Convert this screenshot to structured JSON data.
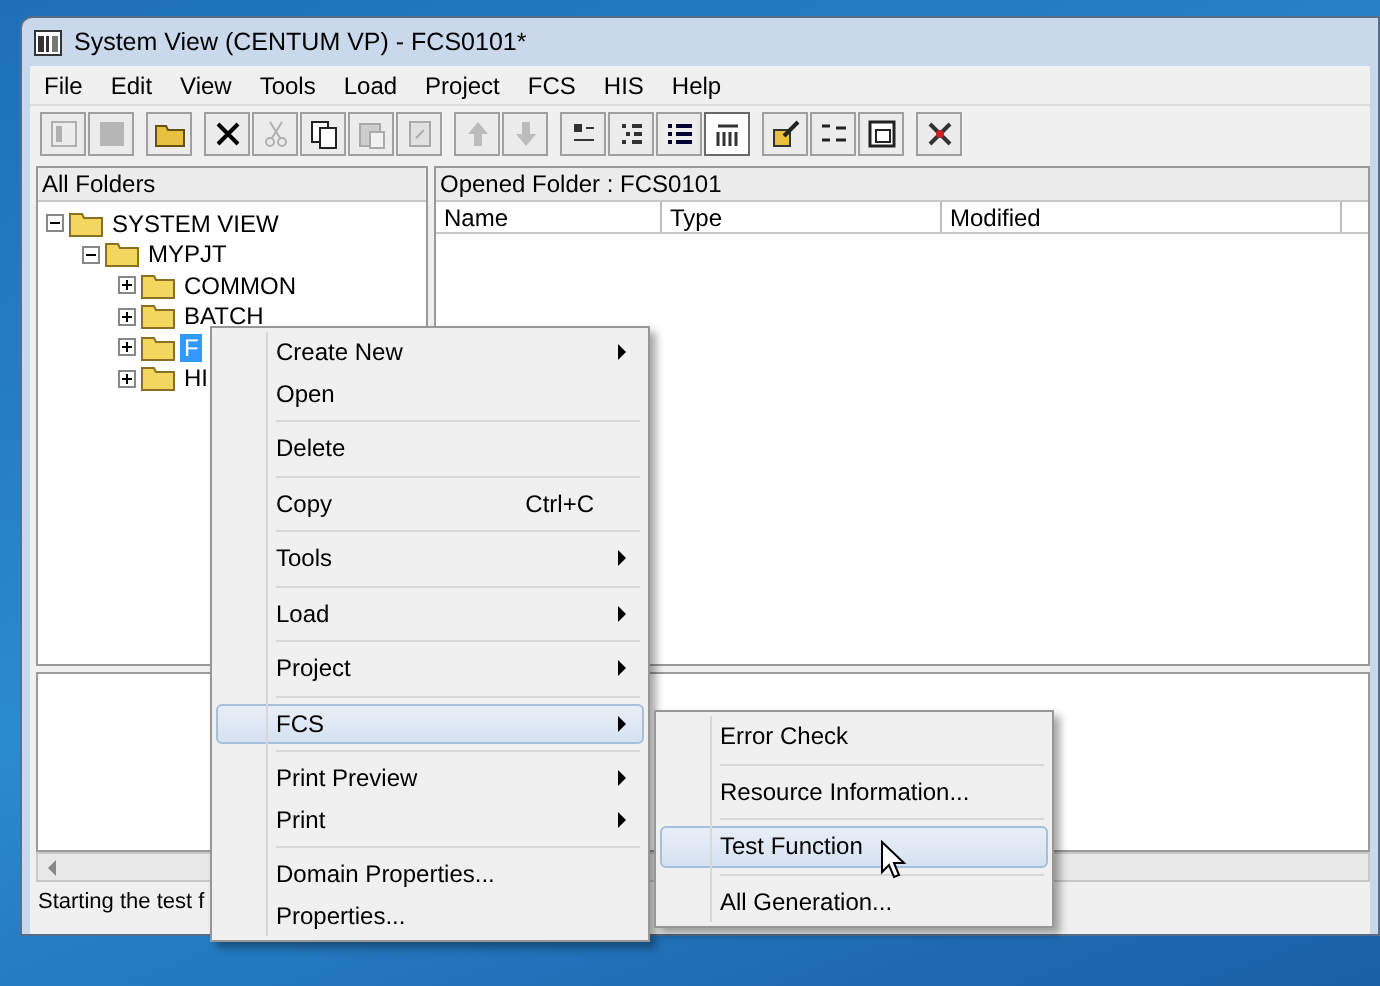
{
  "window": {
    "title": "System View (CENTUM VP) - FCS0101*"
  },
  "menu_bar": [
    "File",
    "Edit",
    "View",
    "Tools",
    "Load",
    "Project",
    "FCS",
    "HIS",
    "Help"
  ],
  "toolbar": {
    "groups": [
      [
        {
          "disabled": true,
          "pressed": false
        },
        {
          "disabled": true,
          "pressed": false
        }
      ],
      [
        {
          "disabled": false,
          "pressed": false
        }
      ],
      [
        {
          "disabled": false,
          "pressed": false
        },
        {
          "disabled": true,
          "pressed": false
        },
        {
          "disabled": false,
          "pressed": false
        },
        {
          "disabled": true,
          "pressed": false
        },
        {
          "disabled": true,
          "pressed": false
        }
      ],
      [
        {
          "disabled": true,
          "pressed": false
        },
        {
          "disabled": true,
          "pressed": false
        }
      ],
      [
        {
          "disabled": false,
          "pressed": false
        },
        {
          "disabled": false,
          "pressed": false
        },
        {
          "disabled": false,
          "pressed": false
        },
        {
          "disabled": false,
          "pressed": true
        }
      ],
      [
        {
          "disabled": false,
          "pressed": false
        },
        {
          "disabled": false,
          "pressed": false
        },
        {
          "disabled": false,
          "pressed": false
        }
      ],
      [
        {
          "disabled": false,
          "pressed": false
        }
      ]
    ]
  },
  "folder_pane": {
    "title": "All Folders",
    "tree": [
      {
        "label": "SYSTEM VIEW",
        "expanded": true,
        "selected": false,
        "children": [
          {
            "label": "MYPJT",
            "expanded": true,
            "selected": false,
            "children": [
              {
                "label": "COMMON",
                "expanded": false,
                "selected": false
              },
              {
                "label": "BATCH",
                "expanded": false,
                "selected": false
              },
              {
                "label": "F",
                "expanded": false,
                "selected": true
              },
              {
                "label": "HI",
                "expanded": false,
                "selected": false
              }
            ]
          }
        ]
      }
    ]
  },
  "content_pane": {
    "title": "Opened Folder : FCS0101",
    "columns": [
      "Name",
      "Type",
      "Modified"
    ]
  },
  "status_bar": "Starting the test f",
  "context_menu": {
    "items": [
      {
        "kind": "item",
        "label": "Create New",
        "submenu": true,
        "selected": false
      },
      {
        "kind": "item",
        "label": "Open",
        "submenu": false,
        "selected": false
      },
      {
        "kind": "separator"
      },
      {
        "kind": "item",
        "label": "Delete",
        "submenu": false,
        "selected": false
      },
      {
        "kind": "separator"
      },
      {
        "kind": "item",
        "label": "Copy",
        "shortcut": "Ctrl+C",
        "submenu": false,
        "selected": false
      },
      {
        "kind": "separator"
      },
      {
        "kind": "item",
        "label": "Tools",
        "submenu": true,
        "selected": false
      },
      {
        "kind": "separator"
      },
      {
        "kind": "item",
        "label": "Load",
        "submenu": true,
        "selected": false
      },
      {
        "kind": "separator"
      },
      {
        "kind": "item",
        "label": "Project",
        "submenu": true,
        "selected": false
      },
      {
        "kind": "separator"
      },
      {
        "kind": "item",
        "label": "FCS",
        "submenu": true,
        "selected": true
      },
      {
        "kind": "separator"
      },
      {
        "kind": "item",
        "label": "Print Preview",
        "submenu": true,
        "selected": false
      },
      {
        "kind": "item",
        "label": "Print",
        "submenu": true,
        "selected": false
      },
      {
        "kind": "separator"
      },
      {
        "kind": "item",
        "label": "Domain Properties...",
        "submenu": false,
        "selected": false
      },
      {
        "kind": "item",
        "label": "Properties...",
        "submenu": false,
        "selected": false
      }
    ]
  },
  "submenu": {
    "items": [
      {
        "kind": "item",
        "label": "Error Check",
        "selected": false
      },
      {
        "kind": "separator"
      },
      {
        "kind": "item",
        "label": "Resource Information...",
        "selected": false
      },
      {
        "kind": "separator"
      },
      {
        "kind": "item",
        "label": "Test Function",
        "selected": true
      },
      {
        "kind": "separator"
      },
      {
        "kind": "item",
        "label": "All Generation...",
        "selected": false
      }
    ]
  }
}
